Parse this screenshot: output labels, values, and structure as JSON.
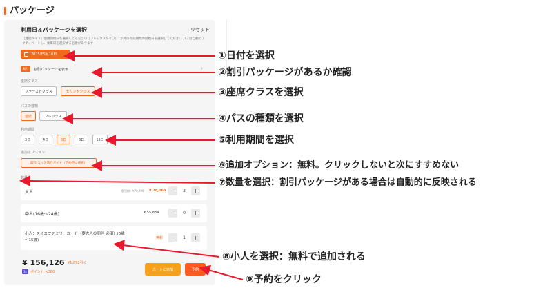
{
  "header": {
    "title": "パッケージ"
  },
  "panel": {
    "title": "利用日＆パッケージを選択",
    "reset": "リセット",
    "description": "［連続タイプ］使用開始日を選択してください［フレックスタイプ］1か月の有効期間の開始日を選択してください パスは自動でアクティベートし、乗車日を選択する必要があります",
    "date": "2025年5月16日",
    "discount_tag": "割引",
    "discount_label": "割引パッケージを表示",
    "seat": {
      "label": "座席クラス",
      "options": [
        "ファーストクラス",
        "セカンドクラス"
      ],
      "selected": "セカンドクラス"
    },
    "pass": {
      "label": "パスの種類",
      "options": [
        "連続",
        "フレックス"
      ],
      "selected": "連続"
    },
    "period": {
      "label": "利用期間",
      "options": [
        "3日",
        "4日",
        "6日",
        "8日",
        "15日"
      ],
      "selected": "6日"
    },
    "addon": {
      "label": "追加オプション",
      "option": "無料 スイス旅行ガイド（予約時に選択）"
    },
    "quantity": {
      "label": "数量",
      "rows": [
        {
          "name": "大人",
          "orig_price": "割引前：¥70,999",
          "price": "¥ 78,063",
          "qty": "2"
        },
        {
          "name": "中人(16歳～24歳)",
          "price": "¥ 55,834",
          "qty": "0"
        },
        {
          "name": "小人：スイスファミリーカード（要大人の同伴 必須）(6歳～15歳)",
          "price": "無料",
          "qty": "1"
        }
      ]
    },
    "total": "¥ 156,126",
    "total_strike": "¥1,872引く",
    "points_badge": "3x",
    "points": "ポイント ×360",
    "cart_button": "カートに追加",
    "book_button": "予約"
  },
  "annotations": [
    "①日付を選択",
    "②割引パッケージがあるか確認",
    "③座席クラスを選択",
    "④パスの種類を選択",
    "⑤利用期間を選択",
    "⑥追加オプション：無料。クリックしないと次にすすめない",
    "⑦数量を選択：割引パッケージがある場合は自動的に反映される",
    "⑧小人を選択：無料で追加される",
    "⑨予約をクリック"
  ],
  "colors": {
    "accent": "#f06a1d",
    "arrow": "#e8192c",
    "panel_bg": "#f5f5f5"
  }
}
